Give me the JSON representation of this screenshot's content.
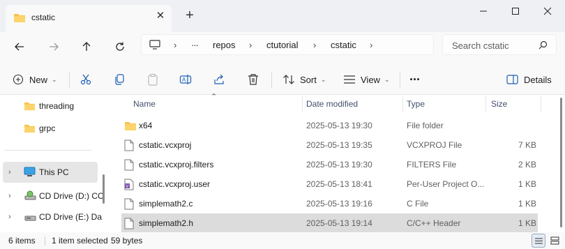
{
  "tab": {
    "title": "cstatic"
  },
  "window": {
    "controls": [
      "minimize",
      "maximize",
      "close"
    ]
  },
  "address": {
    "ellipsis": "···",
    "crumbs": [
      "repos",
      "ctutorial",
      "cstatic"
    ]
  },
  "search": {
    "placeholder": "Search cstatic"
  },
  "toolbar": {
    "new_label": "New",
    "sort_label": "Sort",
    "view_label": "View",
    "more_label": "···",
    "details_label": "Details"
  },
  "sidebar": {
    "items": [
      {
        "label": "threading",
        "icon": "folder-icon"
      },
      {
        "label": "grpc",
        "icon": "folder-icon"
      },
      {
        "label": "This PC",
        "icon": "monitor-icon"
      },
      {
        "label": "CD Drive (D:) CC",
        "icon": "cd-drive-icon"
      },
      {
        "label": "CD Drive (E:) Da",
        "icon": "cd-drive-icon"
      }
    ]
  },
  "columns": {
    "name": "Name",
    "date": "Date modified",
    "type": "Type",
    "size": "Size"
  },
  "files": [
    {
      "name": "x64",
      "date": "2025-05-13 19:30",
      "type": "File folder",
      "size": "",
      "icon": "folder-icon"
    },
    {
      "name": "cstatic.vcxproj",
      "date": "2025-05-13 19:35",
      "type": "VCXPROJ File",
      "size": "7 KB",
      "icon": "file-icon"
    },
    {
      "name": "cstatic.vcxproj.filters",
      "date": "2025-05-13 19:30",
      "type": "FILTERS File",
      "size": "2 KB",
      "icon": "file-icon"
    },
    {
      "name": "cstatic.vcxproj.user",
      "date": "2025-05-13 18:41",
      "type": "Per-User Project O...",
      "size": "1 KB",
      "icon": "vs-project-icon"
    },
    {
      "name": "simplemath2.c",
      "date": "2025-05-13 19:16",
      "type": "C File",
      "size": "1 KB",
      "icon": "file-icon"
    },
    {
      "name": "simplemath2.h",
      "date": "2025-05-13 19:14",
      "type": "C/C++ Header",
      "size": "1 KB",
      "icon": "file-icon",
      "selected": true
    }
  ],
  "status": {
    "items": "6 items",
    "selected": "1 item selected",
    "size": "59 bytes"
  },
  "colors": {
    "folder": "#f8c34a",
    "accent": "#0067c0",
    "selection": "#dcdcdc"
  }
}
